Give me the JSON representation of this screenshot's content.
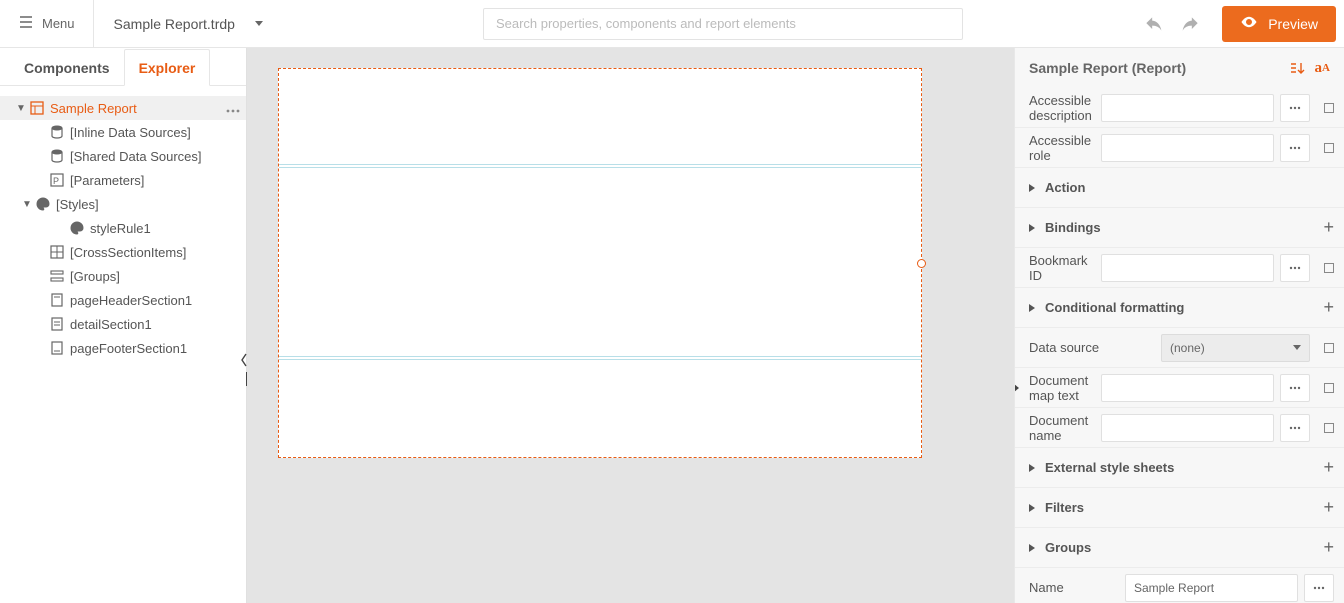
{
  "topbar": {
    "menu_label": "Menu",
    "filename": "Sample Report.trdp",
    "search_placeholder": "Search properties, components and report elements",
    "preview_label": "Preview"
  },
  "left_panel": {
    "tabs": {
      "components": "Components",
      "explorer": "Explorer"
    },
    "tree": {
      "root": "Sample Report",
      "inline_ds": "[Inline Data Sources]",
      "shared_ds": "[Shared Data Sources]",
      "parameters": "[Parameters]",
      "styles": "[Styles]",
      "style_rule": "styleRule1",
      "cross_section": "[CrossSectionItems]",
      "groups": "[Groups]",
      "page_header": "pageHeaderSection1",
      "detail": "detailSection1",
      "page_footer": "pageFooterSection1"
    }
  },
  "properties": {
    "header": "Sample Report (Report)",
    "rows": {
      "accessible_description": "Accessible description",
      "accessible_role": "Accessible role",
      "action": "Action",
      "bindings": "Bindings",
      "bookmark_id": "Bookmark ID",
      "conditional_formatting": "Conditional formatting",
      "data_source": "Data source",
      "data_source_value": "(none)",
      "document_map_text": "Document map text",
      "document_name": "Document name",
      "external_style_sheets": "External style sheets",
      "filters": "Filters",
      "groups": "Groups",
      "name": "Name",
      "name_value": "Sample Report"
    }
  }
}
